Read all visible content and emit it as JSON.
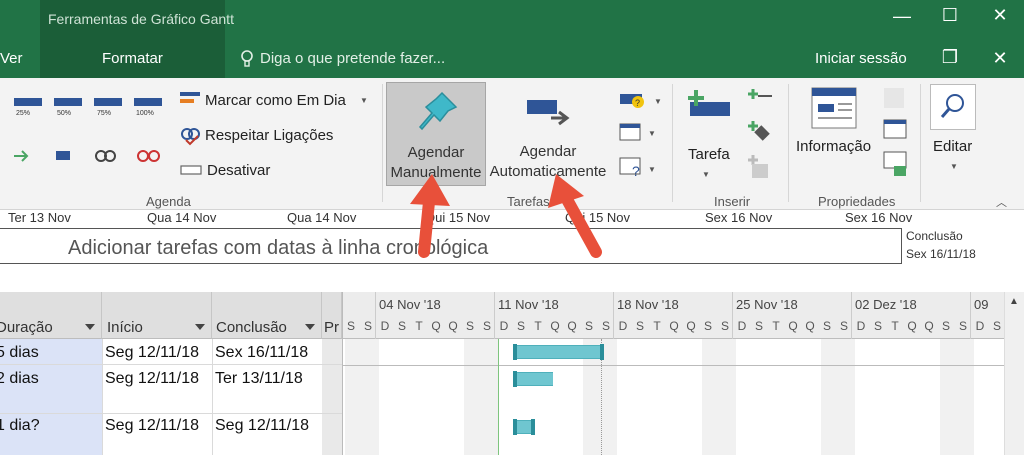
{
  "window": {
    "context_title": "Ferramentas de Gráfico Gantt",
    "minimize": "—",
    "maximize": "☐",
    "close": "✕",
    "restore": "❐"
  },
  "tabs": {
    "ver": "Ver",
    "formatar": "Formatar",
    "tell_me": "Diga o que pretende fazer...",
    "sign_in": "Iniciar sessão"
  },
  "ribbon": {
    "agenda": {
      "label": "Agenda",
      "pct": [
        "25%",
        "50%",
        "75%",
        "100%"
      ],
      "mark_on_track": "Marcar como Em Dia",
      "respect_links": "Respeitar Ligações",
      "deactivate": "Desativar"
    },
    "tarefas": {
      "label": "Tarefas",
      "manual_line1": "Agendar",
      "manual_line2": "Manualmente",
      "auto_line1": "Agendar",
      "auto_line2": "Automaticamente"
    },
    "inserir": {
      "label": "Inserir",
      "task": "Tarefa"
    },
    "propriedades": {
      "label": "Propriedades",
      "info": "Informação"
    },
    "editar": {
      "label": "Editar"
    }
  },
  "timescale": [
    "Ter 13 Nov",
    "Qua 14 Nov",
    "Qua 14 Nov",
    "Qui 15 Nov",
    "Qui 15 Nov",
    "Sex 16 Nov",
    "Sex 16 Nov"
  ],
  "timeline": {
    "placeholder": "Adicionar tarefas com datas à linha cronológica",
    "end_label": "Conclusão",
    "end_date": "Sex 16/11/18"
  },
  "grid": {
    "headers": [
      "Duração",
      "Início",
      "Conclusão",
      "Pr"
    ],
    "rows": [
      {
        "duration": "5 dias",
        "start": "Seg 12/11/18",
        "finish": "Sex 16/11/18"
      },
      {
        "duration": "2 dias",
        "start": "Seg 12/11/18",
        "finish": "Ter 13/11/18"
      },
      {
        "duration": "1 dia?",
        "start": "Seg 12/11/18",
        "finish": "Seg 12/11/18"
      }
    ]
  },
  "gantt": {
    "weeks": [
      "04 Nov '18",
      "11 Nov '18",
      "18 Nov '18",
      "25 Nov '18",
      "02 Dez '18",
      "09"
    ],
    "days": [
      "S",
      "S",
      "D",
      "S",
      "T",
      "Q",
      "Q",
      "S",
      "S",
      "D",
      "S",
      "T",
      "Q",
      "Q",
      "S",
      "S",
      "D",
      "S",
      "T",
      "Q",
      "Q",
      "S",
      "S",
      "D",
      "S",
      "T",
      "Q",
      "Q",
      "S",
      "S",
      "D",
      "S",
      "T",
      "Q",
      "Q",
      "S",
      "S",
      "D",
      "S",
      "T"
    ]
  },
  "colors": {
    "titlebar": "#217346",
    "bar": "#6fc6d0",
    "annotation_arrow": "#e8503a"
  }
}
